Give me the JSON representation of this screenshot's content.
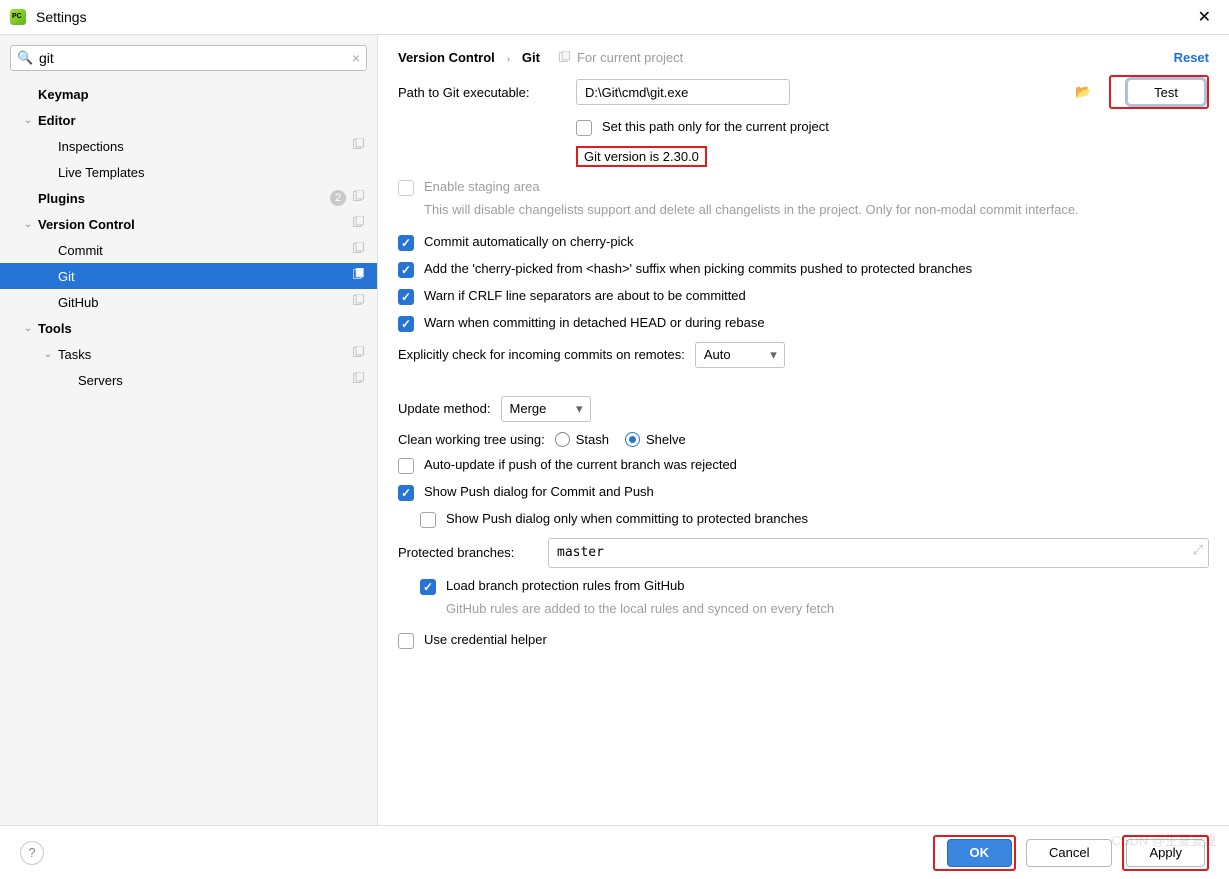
{
  "window": {
    "title": "Settings"
  },
  "search": {
    "value": "git",
    "clear_glyph": "×",
    "mag_glyph": "🔍"
  },
  "sidebar": {
    "items": [
      {
        "label": "Keymap",
        "bold": true,
        "lvl": 0
      },
      {
        "label": "Editor",
        "bold": true,
        "lvl": 0,
        "chev": "⌄"
      },
      {
        "label": "Inspections",
        "lvl": 1,
        "cp": true
      },
      {
        "label": "Live Templates",
        "lvl": 1
      },
      {
        "label": "Plugins",
        "bold": true,
        "lvl": 0,
        "badge": "2",
        "cp": true
      },
      {
        "label": "Version Control",
        "bold": true,
        "lvl": 0,
        "chev": "⌄",
        "cp": true
      },
      {
        "label": "Commit",
        "lvl": 1,
        "cp": true
      },
      {
        "label": "Git",
        "lvl": 1,
        "cp": true,
        "selected": true
      },
      {
        "label": "GitHub",
        "lvl": 1,
        "cp": true
      },
      {
        "label": "Tools",
        "bold": true,
        "lvl": 0,
        "chev": "⌄"
      },
      {
        "label": "Tasks",
        "lvl": 1,
        "chev": "⌄",
        "cp": true
      },
      {
        "label": "Servers",
        "lvl": 2,
        "cp": true
      }
    ]
  },
  "header": {
    "crumb1": "Version Control",
    "crumb2": "Git",
    "for_project": "For current project",
    "reset": "Reset"
  },
  "git": {
    "path_label": "Path to Git executable:",
    "path_value": "D:\\Git\\cmd\\git.exe",
    "test_button": "Test",
    "set_path_only": "Set this path only for the current project",
    "version_text": "Git version is 2.30.0",
    "enable_staging": "Enable staging area",
    "enable_staging_help": "This will disable changelists support and delete all changelists in the project. Only for non-modal commit interface.",
    "commit_auto": "Commit automatically on cherry-pick",
    "cherry_suffix": "Add the 'cherry-picked from <hash>' suffix when picking commits pushed to protected branches",
    "warn_crlf": "Warn if CRLF line separators are about to be committed",
    "warn_detached": "Warn when committing in detached HEAD or during rebase",
    "explicit_check_label": "Explicitly check for incoming commits on remotes:",
    "explicit_check_value": "Auto",
    "update_method_label": "Update method:",
    "update_method_value": "Merge",
    "clean_tree_label": "Clean working tree using:",
    "clean_stash": "Stash",
    "clean_shelve": "Shelve",
    "auto_update_push": "Auto-update if push of the current branch was rejected",
    "show_push_dialog": "Show Push dialog for Commit and Push",
    "show_push_protected": "Show Push dialog only when committing to protected branches",
    "protected_label": "Protected branches:",
    "protected_value": "master",
    "load_branch_rules": "Load branch protection rules from GitHub",
    "load_branch_help": "GitHub rules are added to the local rules and synced on every fetch",
    "use_credential": "Use credential helper"
  },
  "footer": {
    "ok": "OK",
    "cancel": "Cancel",
    "apply": "Apply"
  },
  "watermark": "CSDN @生夏夏夏"
}
